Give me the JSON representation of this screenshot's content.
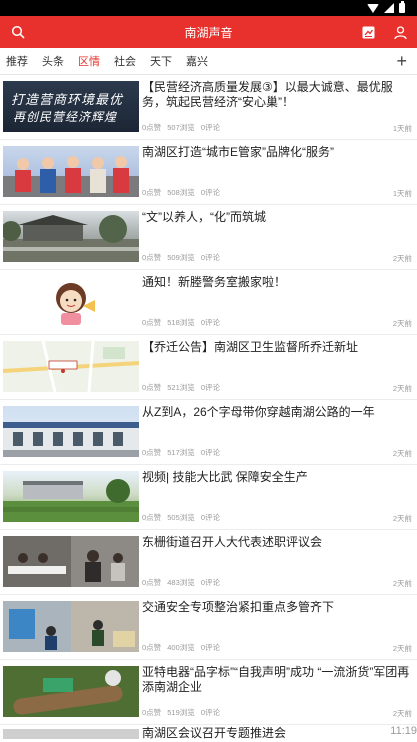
{
  "status_bar": {
    "time": "11:19"
  },
  "app_bar": {
    "title": "南湖声音",
    "search_icon": "search-icon",
    "doc_icon": "document-icon",
    "user_icon": "user-icon"
  },
  "tabs": [
    {
      "label": "推荐"
    },
    {
      "label": "头条"
    },
    {
      "label": "区情"
    },
    {
      "label": "社会"
    },
    {
      "label": "天下"
    },
    {
      "label": "嘉兴"
    }
  ],
  "active_tab": "区情",
  "add_tab_icon": "plus-icon",
  "items": [
    {
      "headline": "【民营经济高质量发展③】以最大诚意、最优服务，筑起民营经济“安心巢”！",
      "likes": "0点赞",
      "views": "507浏览",
      "comments": "0评论",
      "time": "1天前",
      "image_text_1": "打造营商环境最优",
      "image_text_2": "再创民营经济辉煌"
    },
    {
      "headline": "南湖区打造“城市E管家”品牌化“服务”",
      "likes": "0点赞",
      "views": "508浏览",
      "comments": "0评论",
      "time": "1天前"
    },
    {
      "headline": "“文”以养人，“化”而筑城",
      "likes": "0点赞",
      "views": "509浏览",
      "comments": "0评论",
      "time": "2天前"
    },
    {
      "headline": "通知！新塍警务室搬家啦！",
      "likes": "0点赞",
      "views": "518浏览",
      "comments": "0评论",
      "time": "2天前"
    },
    {
      "headline": "【乔迁公告】南湖区卫生监督所乔迁新址",
      "likes": "0点赞",
      "views": "521浏览",
      "comments": "0评论",
      "time": "2天前"
    },
    {
      "headline": "从Z到A，26个字母带你穿越南湖公路的一年",
      "likes": "0点赞",
      "views": "517浏览",
      "comments": "0评论",
      "time": "2天前"
    },
    {
      "headline": "视频|  技能大比武 保障安全生产",
      "likes": "0点赞",
      "views": "505浏览",
      "comments": "0评论",
      "time": "2天前"
    },
    {
      "headline": "东栅街道召开人大代表述职评议会",
      "likes": "0点赞",
      "views": "483浏览",
      "comments": "0评论",
      "time": "2天前"
    },
    {
      "headline": "交通安全专项整治紧扣重点多管齐下",
      "likes": "0点赞",
      "views": "400浏览",
      "comments": "0评论",
      "time": "2天前"
    },
    {
      "headline": "亚特电器“品字标”“自我声明”成功 “一流浙货”军团再添南湖企业",
      "likes": "0点赞",
      "views": "519浏览",
      "comments": "0评论",
      "time": "2天前"
    },
    {
      "headline": "南湖区会议召开专题推进会",
      "likes": "",
      "views": "",
      "comments": "",
      "time": ""
    }
  ]
}
